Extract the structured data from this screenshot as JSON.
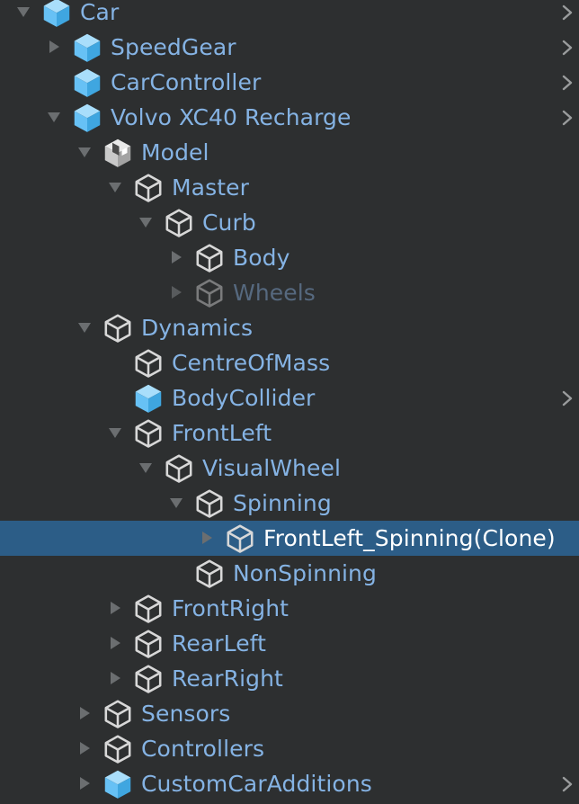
{
  "hierarchy": {
    "rows": [
      {
        "label": "Car",
        "depth": 0,
        "expand": "expanded",
        "icon": "prefab-cube-icon",
        "chevron": true
      },
      {
        "label": "SpeedGear",
        "depth": 1,
        "expand": "collapsed",
        "icon": "prefab-cube-icon",
        "chevron": true
      },
      {
        "label": "CarController",
        "depth": 1,
        "expand": "none",
        "icon": "prefab-cube-icon",
        "chevron": true
      },
      {
        "label": "Volvo XC40 Recharge",
        "depth": 1,
        "expand": "expanded",
        "icon": "prefab-cube-icon",
        "chevron": true
      },
      {
        "label": "Model",
        "depth": 2,
        "expand": "expanded",
        "icon": "model-prefab-icon",
        "chevron": false
      },
      {
        "label": "Master",
        "depth": 3,
        "expand": "expanded",
        "icon": "gameobject-icon",
        "chevron": false
      },
      {
        "label": "Curb",
        "depth": 4,
        "expand": "expanded",
        "icon": "gameobject-icon",
        "chevron": false
      },
      {
        "label": "Body",
        "depth": 5,
        "expand": "collapsed",
        "icon": "gameobject-icon",
        "chevron": false
      },
      {
        "label": "Wheels",
        "depth": 5,
        "expand": "collapsed",
        "icon": "gameobject-icon",
        "chevron": false,
        "disabled": true
      },
      {
        "label": "Dynamics",
        "depth": 2,
        "expand": "expanded",
        "icon": "gameobject-icon",
        "chevron": false
      },
      {
        "label": "CentreOfMass",
        "depth": 3,
        "expand": "none",
        "icon": "gameobject-icon",
        "chevron": false
      },
      {
        "label": "BodyCollider",
        "depth": 3,
        "expand": "none",
        "icon": "prefab-cube-icon",
        "chevron": true
      },
      {
        "label": "FrontLeft",
        "depth": 3,
        "expand": "expanded",
        "icon": "gameobject-icon",
        "chevron": false
      },
      {
        "label": "VisualWheel",
        "depth": 4,
        "expand": "expanded",
        "icon": "gameobject-icon",
        "chevron": false
      },
      {
        "label": "Spinning",
        "depth": 5,
        "expand": "expanded",
        "icon": "gameobject-icon",
        "chevron": false
      },
      {
        "label": "FrontLeft_Spinning(Clone)",
        "depth": 6,
        "expand": "collapsed",
        "icon": "gameobject-icon",
        "chevron": false,
        "selected": true
      },
      {
        "label": "NonSpinning",
        "depth": 5,
        "expand": "none",
        "icon": "gameobject-icon",
        "chevron": false
      },
      {
        "label": "FrontRight",
        "depth": 3,
        "expand": "collapsed",
        "icon": "gameobject-icon",
        "chevron": false
      },
      {
        "label": "RearLeft",
        "depth": 3,
        "expand": "collapsed",
        "icon": "gameobject-icon",
        "chevron": false
      },
      {
        "label": "RearRight",
        "depth": 3,
        "expand": "collapsed",
        "icon": "gameobject-icon",
        "chevron": false
      },
      {
        "label": "Sensors",
        "depth": 2,
        "expand": "collapsed",
        "icon": "gameobject-icon",
        "chevron": false
      },
      {
        "label": "Controllers",
        "depth": 2,
        "expand": "collapsed",
        "icon": "gameobject-icon",
        "chevron": false
      },
      {
        "label": "CustomCarAdditions",
        "depth": 2,
        "expand": "collapsed",
        "icon": "prefab-cube-icon",
        "chevron": true
      }
    ]
  },
  "colors": {
    "background": "#2d2f30",
    "label": "#85b3e4",
    "label_disabled": "#56697f",
    "selected_row": "#2c5d87",
    "selected_label": "#ffffff",
    "prefab_icon": "#67c1f5",
    "arrow": "#6b6e70"
  }
}
